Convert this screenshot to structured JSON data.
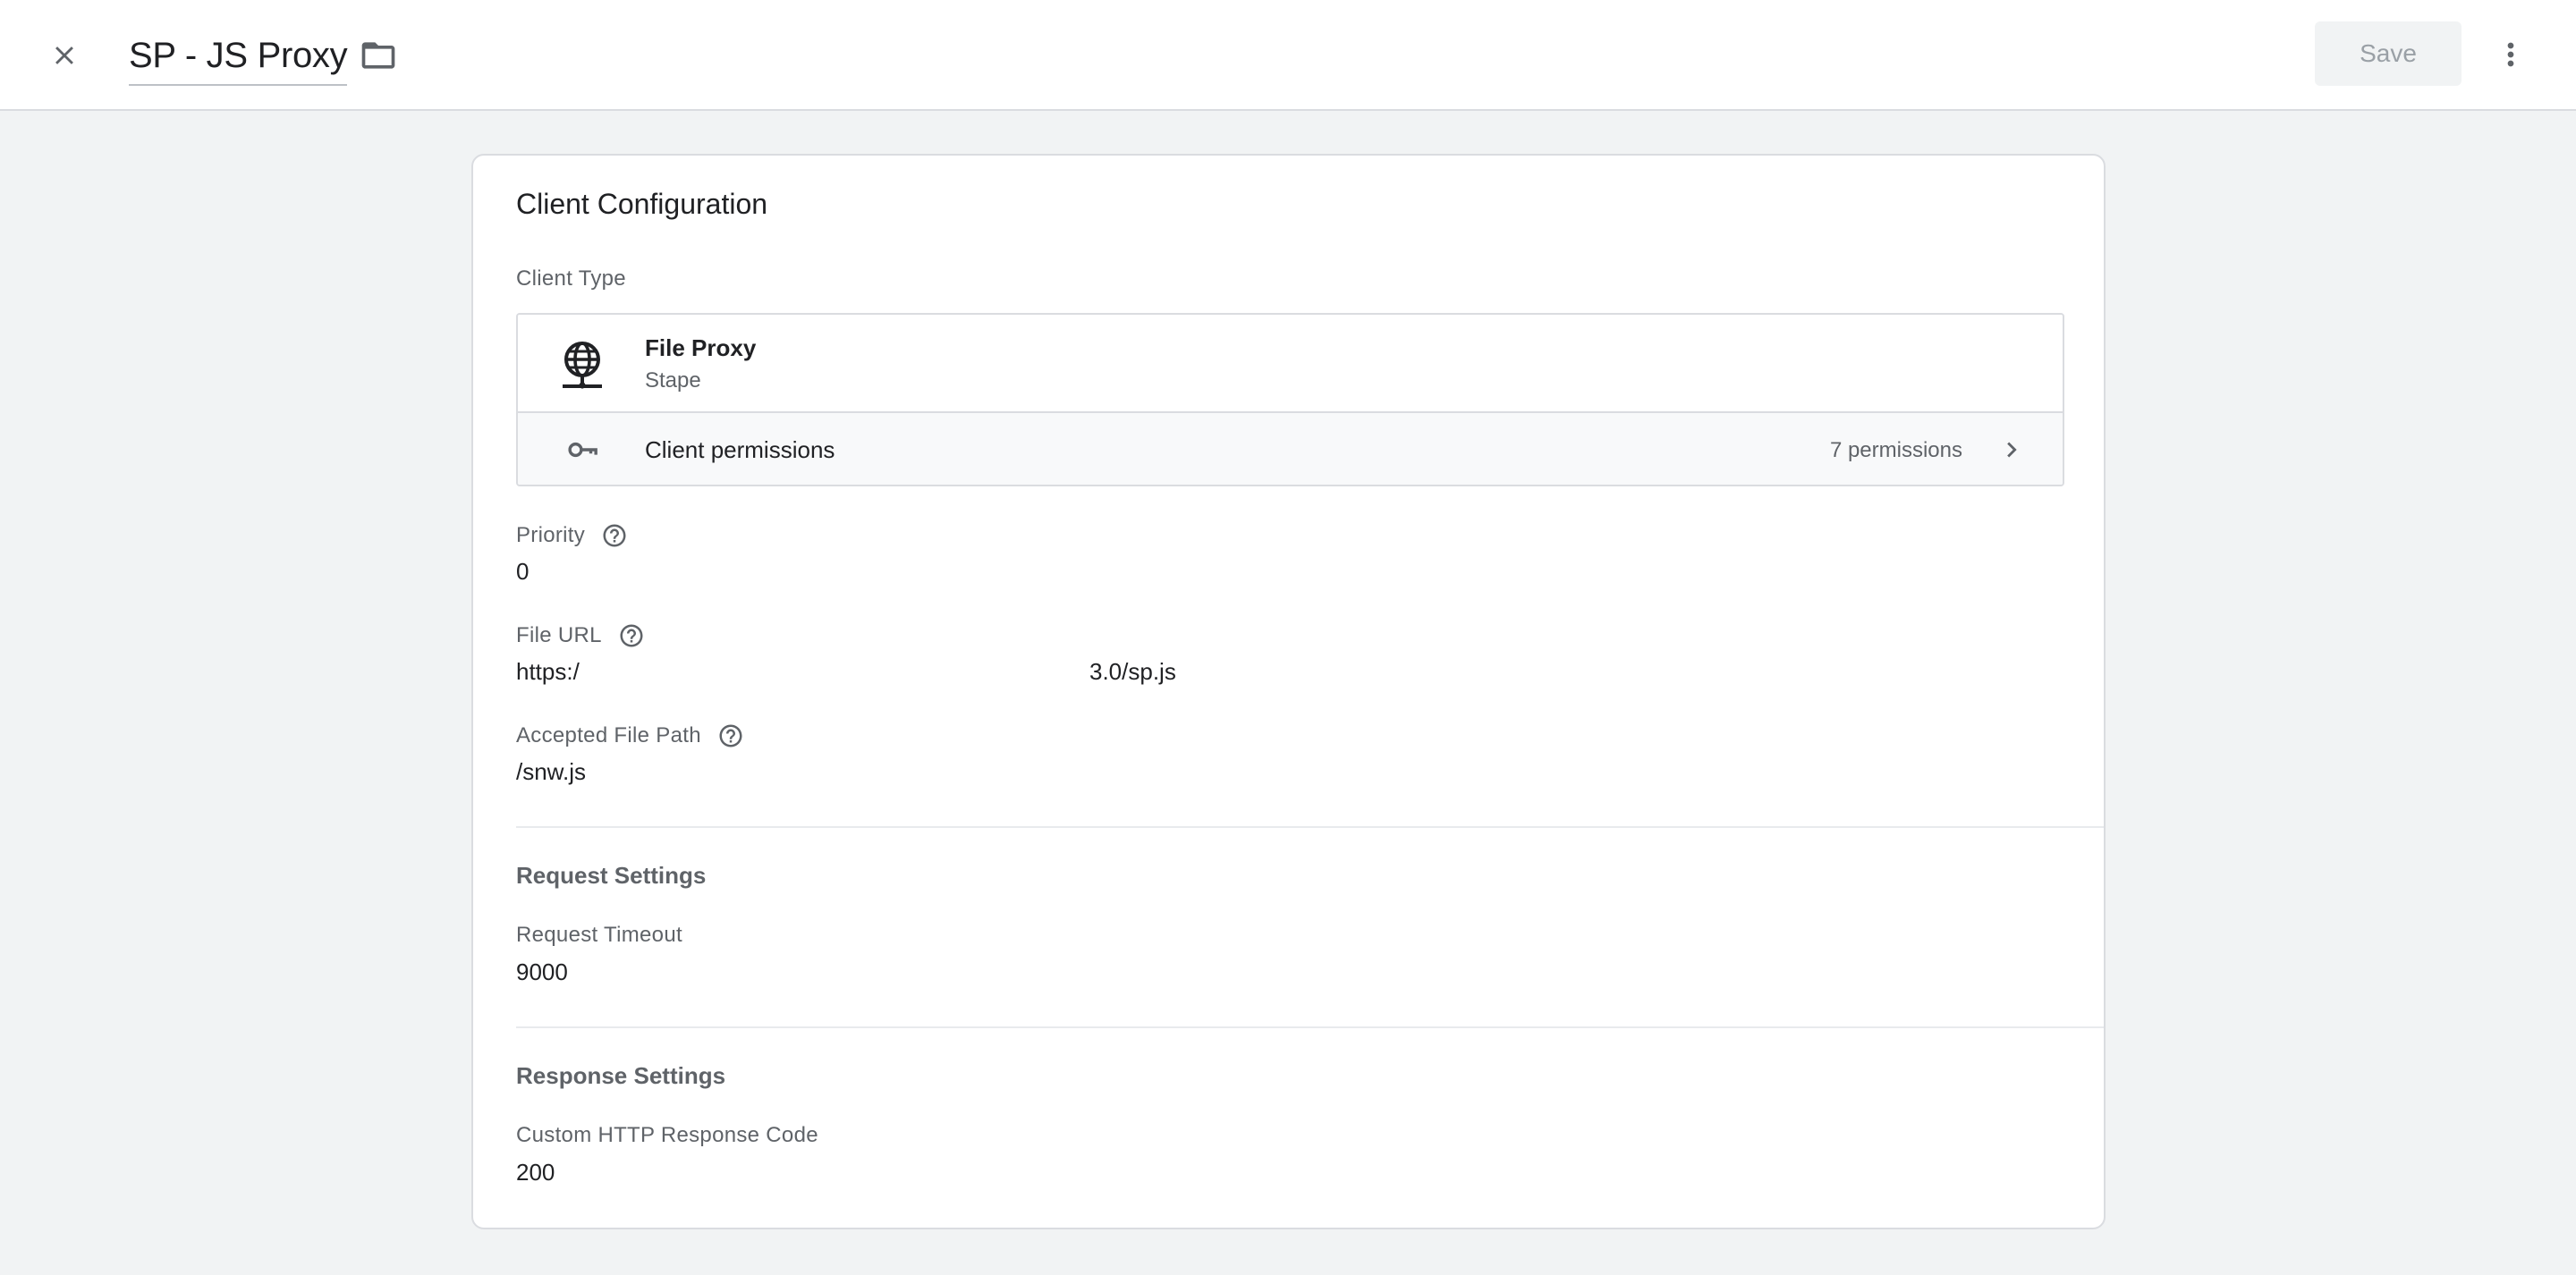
{
  "header": {
    "title": "SP - JS Proxy",
    "save_label": "Save"
  },
  "card": {
    "title": "Client Configuration",
    "client_type_label": "Client Type",
    "client_type": {
      "name": "File Proxy",
      "vendor": "Stape",
      "icon": "globe-network-icon"
    },
    "permissions": {
      "label": "Client permissions",
      "count_text": "7 permissions",
      "icon": "key-icon"
    },
    "fields": {
      "priority": {
        "label": "Priority",
        "value": "0"
      },
      "file_url": {
        "label": "File URL",
        "value_start": "https:/",
        "value_end": "3.0/sp.js"
      },
      "accepted_path": {
        "label": "Accepted File Path",
        "value": "/snw.js"
      }
    },
    "request_settings": {
      "title": "Request Settings",
      "timeout_label": "Request Timeout",
      "timeout_value": "9000"
    },
    "response_settings": {
      "title": "Response Settings",
      "code_label": "Custom HTTP Response Code",
      "code_value": "200"
    }
  },
  "colors": {
    "background": "#f1f3f4",
    "card": "#ffffff",
    "border": "#dadce0",
    "text_primary": "#202124",
    "text_secondary": "#5f6368"
  }
}
